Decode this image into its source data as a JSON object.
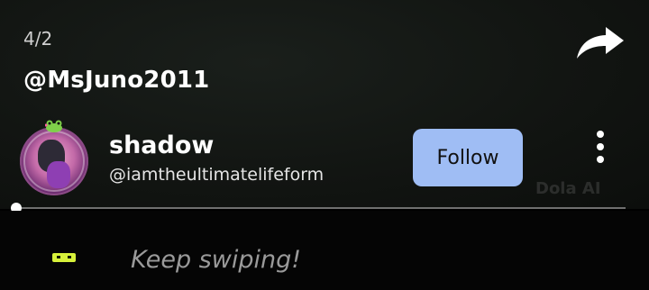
{
  "post": {
    "date": "4/2",
    "handle": "@MsJuno2011"
  },
  "profile": {
    "display_name": "shadow",
    "username": "@iamtheultimatelifeform"
  },
  "actions": {
    "follow_label": "Follow",
    "share_icon": "share-arrow-icon",
    "more_icon": "more-vertical-icon"
  },
  "watermark": "Dola AI",
  "bottom": {
    "hint": "Keep swiping!"
  },
  "colors": {
    "follow_button": "#9fbdf4",
    "chip": "#d7f13a"
  }
}
